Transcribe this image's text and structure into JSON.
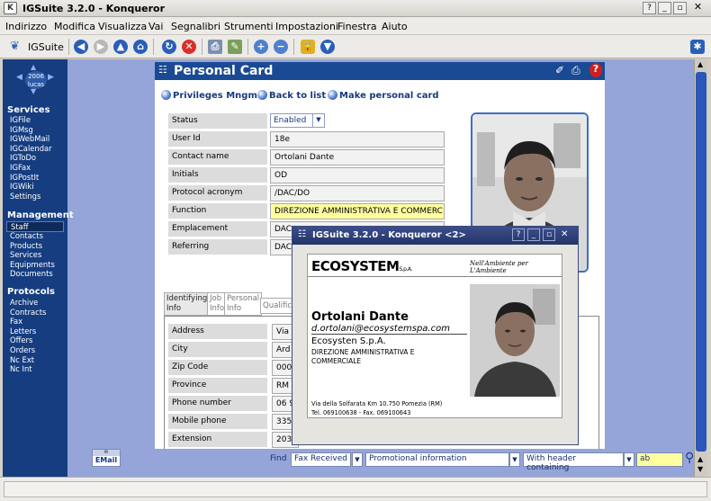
{
  "window": {
    "title": "IGSuite 3.2.0 - Konqueror",
    "help": "?",
    "minimize": "_",
    "maximize": "▫",
    "close": "✕"
  },
  "menu": [
    "Indirizzo",
    "Modifica",
    "Visualizza",
    "Vai",
    "Segnalibri",
    "Strumenti",
    "Impostazioni",
    "Finestra",
    "Aiuto"
  ],
  "toolbar": {
    "app_label": "IGSuite"
  },
  "sidebar": {
    "year": "2006",
    "user": "lucas",
    "services_title": "Services",
    "services": [
      "IGFile",
      "IGMsg",
      "IGWebMail",
      "IGCalendar",
      "IGToDo",
      "IGFax",
      "IGPostIt",
      "IGWiki",
      "Settings"
    ],
    "management_title": "Management",
    "management": [
      "Staff",
      "Contacts",
      "Products",
      "Services",
      "Equipments",
      "Documents"
    ],
    "protocols_title": "Protocols",
    "protocols": [
      "Archive",
      "Contracts",
      "Fax",
      "Letters",
      "Offers",
      "Orders",
      "Nc Ext",
      "Nc Int"
    ]
  },
  "page": {
    "title": "Personal Card",
    "links": {
      "privileges": "Privileges Mngm",
      "back": "Back to list",
      "make": "Make personal card"
    },
    "fields": {
      "status": {
        "label": "Status",
        "value": "Enabled"
      },
      "user_id": {
        "label": "User Id",
        "value": "18e"
      },
      "contact_name": {
        "label": "Contact name",
        "value": "Ortolani Dante"
      },
      "initials": {
        "label": "Initials",
        "value": "OD"
      },
      "protocol_acronym": {
        "label": "Protocol acronym",
        "value": "/DAC/DO"
      },
      "function": {
        "label": "Function",
        "value": "DIREZIONE AMMINISTRATIVA E COMMERC"
      },
      "emplacement": {
        "label": "Emplacement",
        "value": "DAC"
      },
      "referring": {
        "label": "Referring",
        "value": "DAC"
      }
    },
    "tabs": {
      "t1a": "Identifying",
      "t1b": "Info",
      "t2a": "Job",
      "t2b": "Info",
      "t3a": "Personal",
      "t3b": "Info",
      "t4": "Qualific"
    },
    "info_fields": {
      "address": {
        "label": "Address",
        "value": "Via"
      },
      "city": {
        "label": "City",
        "value": "Ard"
      },
      "zip": {
        "label": "Zip Code",
        "value": "000"
      },
      "province": {
        "label": "Province",
        "value": "RM"
      },
      "phone": {
        "label": "Phone number",
        "value": "06 9"
      },
      "mobile": {
        "label": "Mobile phone",
        "value": "335"
      },
      "extension": {
        "label": "Extension",
        "value": "203"
      }
    }
  },
  "bottom": {
    "email_badge": "EMail",
    "find_label": "Find",
    "find_type": "Fax Received",
    "find_field": "Promotional information",
    "find_mode": "With header containing",
    "find_value": "ab"
  },
  "popup": {
    "title": "IGSuite 3.2.0 - Konqueror <2>",
    "help": "?",
    "minimize": "_",
    "maximize": "▫",
    "close": "✕",
    "logo": "ECOSYSTEM",
    "logo_suffix": "S.p.A.",
    "tagline": "Nell'Ambiente per L'Ambiente",
    "name": "Ortolani Dante",
    "email": "d.ortolani@ecosystemspa.com",
    "company": "Ecosysten S.p.A.",
    "role_line1": "DIREZIONE AMMINISTRATIVA E",
    "role_line2": "COMMERCIALE",
    "address": "Via della Solfarata Km 10.750 Pomezia (RM)",
    "contacts": "Tel. 069100638 - Fax. 069100643"
  },
  "colors": {
    "sidebar": "#153d80",
    "header": "#1a4a93",
    "page_bg": "#95a5d9",
    "highlight": "#ffffa0"
  }
}
